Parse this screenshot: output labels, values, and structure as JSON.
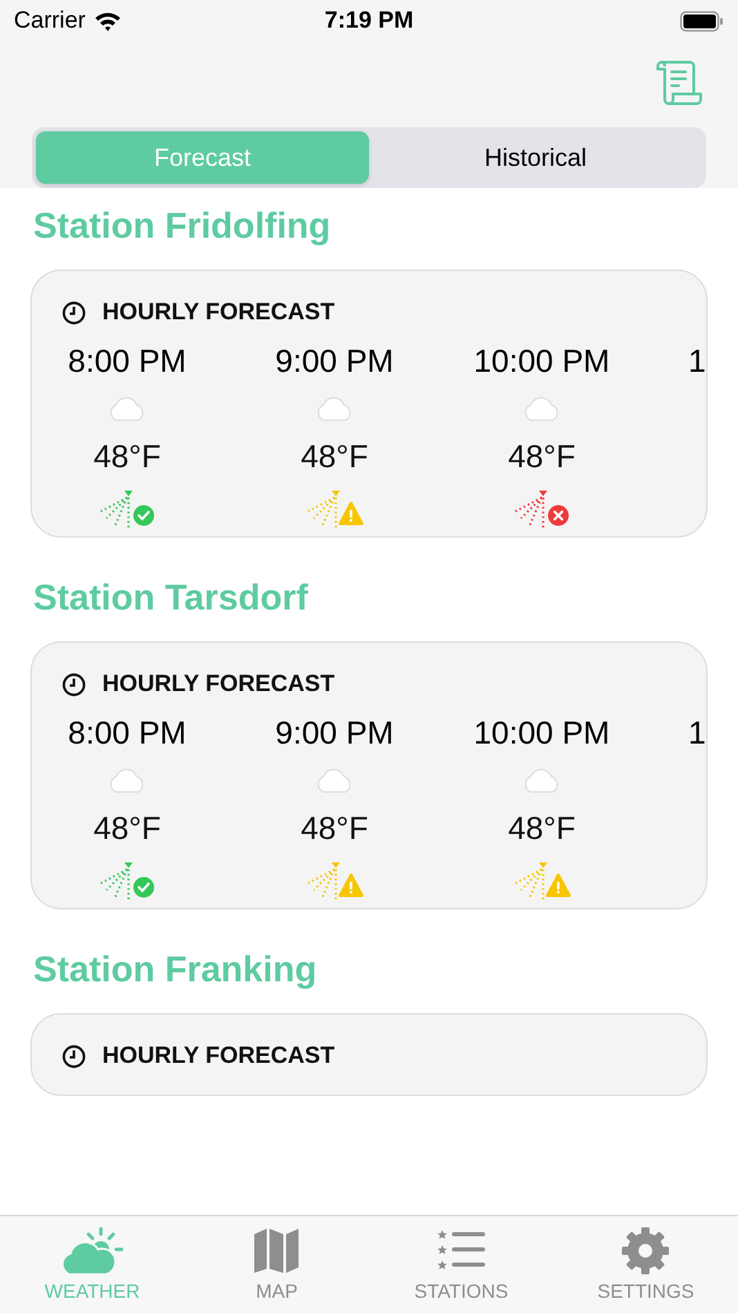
{
  "status_bar": {
    "carrier": "Carrier",
    "time": "7:19 PM"
  },
  "segments": [
    {
      "label": "Forecast",
      "selected": true
    },
    {
      "label": "Historical",
      "selected": false
    }
  ],
  "stations": [
    {
      "name": "Station Fridolfing",
      "card_title": "HOURLY FORECAST",
      "hours": [
        {
          "time": "8:00 PM",
          "temp": "48°F",
          "kind": "ok"
        },
        {
          "time": "9:00 PM",
          "temp": "48°F",
          "kind": "warning"
        },
        {
          "time": "10:00 PM",
          "temp": "48°F",
          "kind": "bad"
        },
        {
          "time": "1",
          "kind": "partial"
        }
      ]
    },
    {
      "name": "Station Tarsdorf",
      "card_title": "HOURLY FORECAST",
      "hours": [
        {
          "time": "8:00 PM",
          "temp": "48°F",
          "kind": "ok"
        },
        {
          "time": "9:00 PM",
          "temp": "48°F",
          "kind": "warning"
        },
        {
          "time": "10:00 PM",
          "temp": "48°F",
          "kind": "warning"
        },
        {
          "time": "1",
          "kind": "partial"
        }
      ]
    },
    {
      "name": "Station Franking",
      "card_title": "HOURLY FORECAST"
    }
  ],
  "tab_bar": [
    {
      "label": "WEATHER",
      "kind": "weather",
      "selected": true
    },
    {
      "label": "MAP",
      "kind": "map",
      "selected": false
    },
    {
      "label": "STATIONS",
      "kind": "list",
      "selected": false
    },
    {
      "label": "SETTINGS",
      "kind": "gear",
      "selected": false
    }
  ]
}
